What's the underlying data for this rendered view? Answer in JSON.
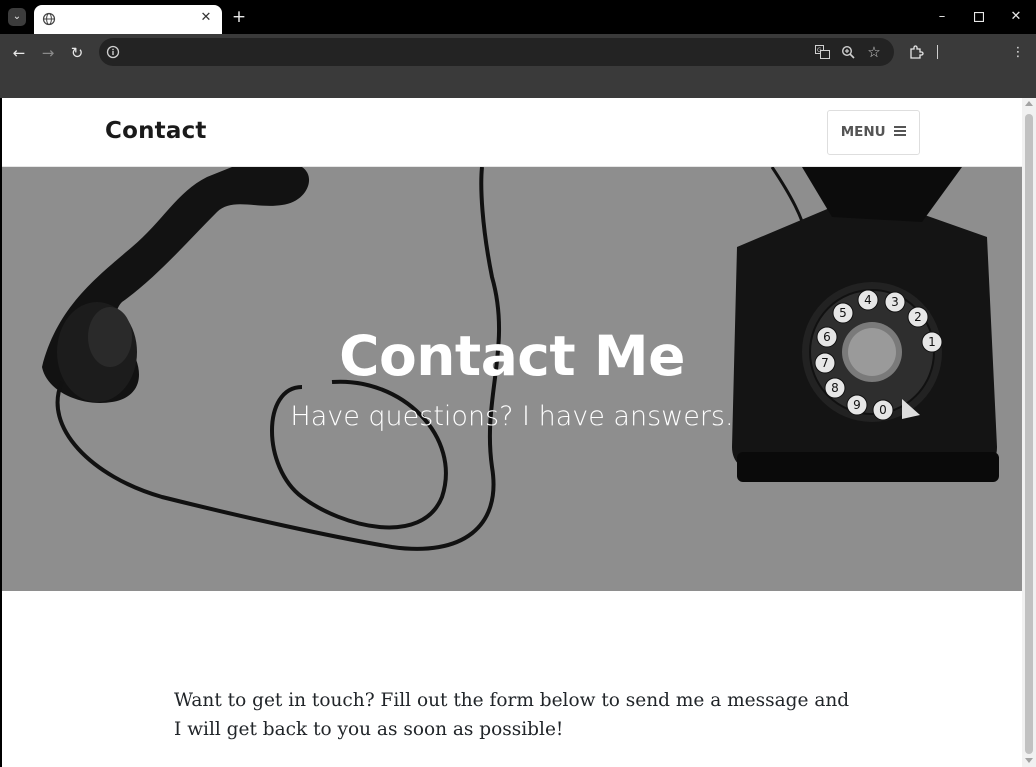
{
  "browser": {
    "tab": {
      "title": ""
    },
    "url": "",
    "icons": {
      "tab_search": "chevron-down-icon",
      "tab_favicon": "globe-icon",
      "tab_close": "close-icon",
      "new_tab": "plus-icon",
      "minimize": "minimize-icon",
      "maximize": "maximize-icon",
      "close_window": "close-icon",
      "back": "arrow-left-icon",
      "forward": "arrow-right-icon",
      "reload": "reload-icon",
      "site_info": "info-icon",
      "translate": "translate-icon",
      "zoom": "zoom-icon",
      "bookmark": "star-icon",
      "extensions": "puzzle-icon",
      "more": "more-vertical-icon"
    }
  },
  "site": {
    "brand": "Contact",
    "menu_label": "MENU"
  },
  "hero": {
    "title": "Contact Me",
    "subtitle": "Have questions? I have answers."
  },
  "main": {
    "intro": "Want to get in touch? Fill out the form below to send me a message and I will get back to you as soon as possible!"
  },
  "colors": {
    "hero_overlay": "#8e8e8e",
    "text": "#212529",
    "chrome_dark": "#3a3a3a"
  }
}
